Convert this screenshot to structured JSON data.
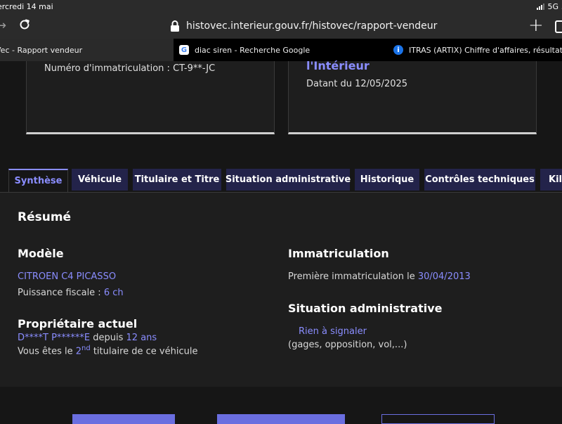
{
  "status_bar": {
    "time": "ercredi 14 mai",
    "network": "5G",
    "extra": "5"
  },
  "browser": {
    "url": "histovec.interieur.gouv.fr/histovec/rapport-vendeur"
  },
  "tabs": [
    {
      "title": "Vec - Rapport vendeur",
      "active": true
    },
    {
      "title": "diac siren - Recherche Google",
      "favicon": "G",
      "active": false
    },
    {
      "title": "ITRAS (ARTIX) Chiffre d'affaires, résultat, bilans",
      "favicon": "i",
      "active": false
    }
  ],
  "cards": {
    "left": {
      "registration": "Numéro d'immatriculation : CT-9**-JC"
    },
    "right": {
      "title": "l'Intérieur",
      "date": "Datant du 12/05/2025"
    }
  },
  "page_tabs": [
    "Synthèse",
    "Véhicule",
    "Titulaire et Titre",
    "Situation administrative",
    "Historique",
    "Contrôles techniques",
    "Kilo"
  ],
  "summary": {
    "heading": "Résumé",
    "model": {
      "heading": "Modèle",
      "name": "CITROEN C4 PICASSO",
      "power_label": "Puissance fiscale : ",
      "power_value": "6 ch"
    },
    "owner": {
      "heading": "Propriétaire actuel",
      "name": "D****T P******E",
      "since_label": " depuis ",
      "since_value": "12 ans",
      "rank_prefix": "Vous êtes le ",
      "rank_number": "2",
      "rank_sup": "nd",
      "rank_suffix": " titulaire de ce véhicule"
    },
    "registration": {
      "heading": "Immatriculation",
      "first_label": "Première immatriculation le ",
      "first_date": "30/04/2013"
    },
    "admin": {
      "heading": "Situation administrative",
      "status": "Rien à signaler",
      "details": "(gages, opposition, vol,...)"
    }
  },
  "colors": {
    "accent": "#8a8dff",
    "tab_bg": "#23234a",
    "background": "#161616"
  }
}
